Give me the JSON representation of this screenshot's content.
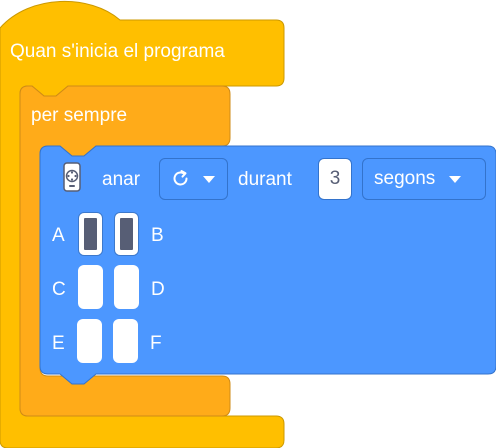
{
  "hat_block": {
    "label": "Quan s'inicia el programa"
  },
  "loop_block": {
    "label": "per sempre"
  },
  "motor_block": {
    "icon": "motor-remote-icon",
    "action_label": "anar",
    "direction_icon": "rotate-clockwise-icon",
    "during_label": "durant",
    "duration_value": "3",
    "unit_label": "segons"
  },
  "segments": [
    {
      "label": "A",
      "on": true
    },
    {
      "label": "B",
      "on": true
    },
    {
      "label": "C",
      "on": false
    },
    {
      "label": "D",
      "on": false
    },
    {
      "label": "E",
      "on": false
    },
    {
      "label": "F",
      "on": false
    }
  ],
  "colors": {
    "events": "#ffbf00",
    "events_border": "#cc9900",
    "control": "#ffab19",
    "control_border": "#cf8b17",
    "motion": "#4c97ff",
    "motion_border": "#3373cc"
  }
}
